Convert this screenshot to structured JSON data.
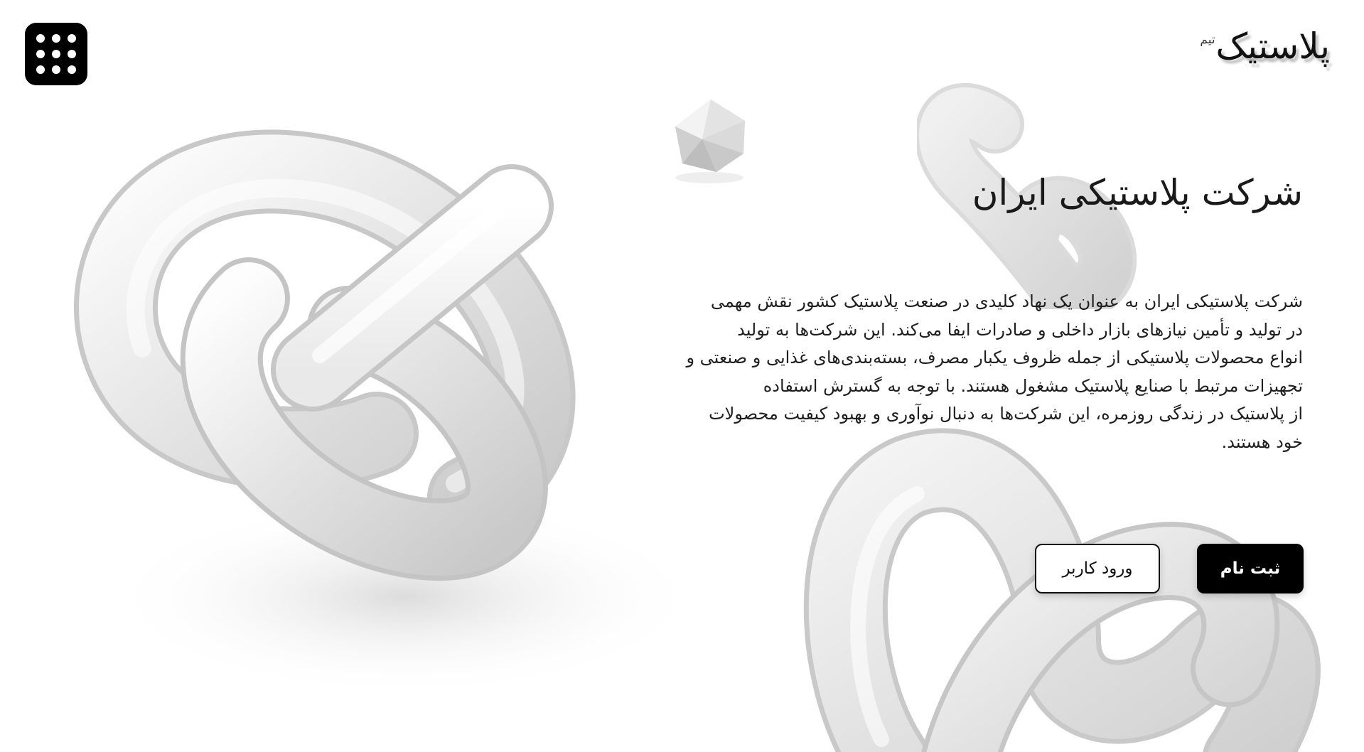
{
  "header": {
    "logo_text": "پلاستیک",
    "logo_superscript": "تیم",
    "menu_icon": "grid-dots-icon"
  },
  "hero": {
    "title": "شرکت پلاستیکی ایران",
    "description_lines": [
      "شرکت پلاستیکی ایران به عنوان یک نهاد کلیدی در صنعت پلاستیک کشور نقش مهمی",
      "در تولید و تأمین نیازهای بازار داخلی و صادرات ایفا می‌کند. این شرکت‌ها به تولید",
      "انواع محصولات پلاستیکی از جمله ظروف یکبار مصرف، بسته‌بندی‌های غذایی و صنعتی و",
      "تجهیزات مرتبط با صنایع پلاستیک مشغول هستند. با توجه به گسترش استفاده",
      "از پلاستیک در زندگی روزمره، این شرکت‌ها به دنبال نوآوری و بهبود کیفیت محصولات",
      "خود هستند."
    ]
  },
  "actions": {
    "signup_label": "ثبت نام",
    "login_label": "ورود کاربر"
  },
  "colors": {
    "background": "#ffffff",
    "primary": "#000000",
    "text": "#1a1a1a",
    "decor": "#e6e6e6"
  }
}
